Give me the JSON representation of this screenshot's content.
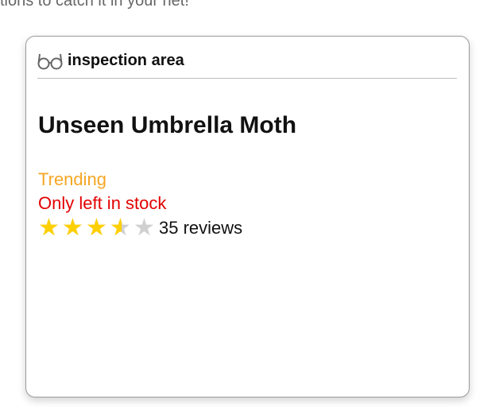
{
  "page": {
    "partial_heading": "tions to catch it in your net!"
  },
  "card": {
    "header_icon": "glasses-icon",
    "header_title": "inspection area",
    "product_title": "Unseen Umbrella Moth",
    "trending_label": "Trending",
    "stock_label": "Only left in stock",
    "rating": {
      "value": 3.5,
      "max": 5,
      "reviews_label": "35 reviews"
    }
  },
  "colors": {
    "trending": "#f5a623",
    "stock": "#e30000",
    "star_filled": "#ffd000",
    "star_empty": "#d0d0d0",
    "left_card_border": "#d00000"
  }
}
